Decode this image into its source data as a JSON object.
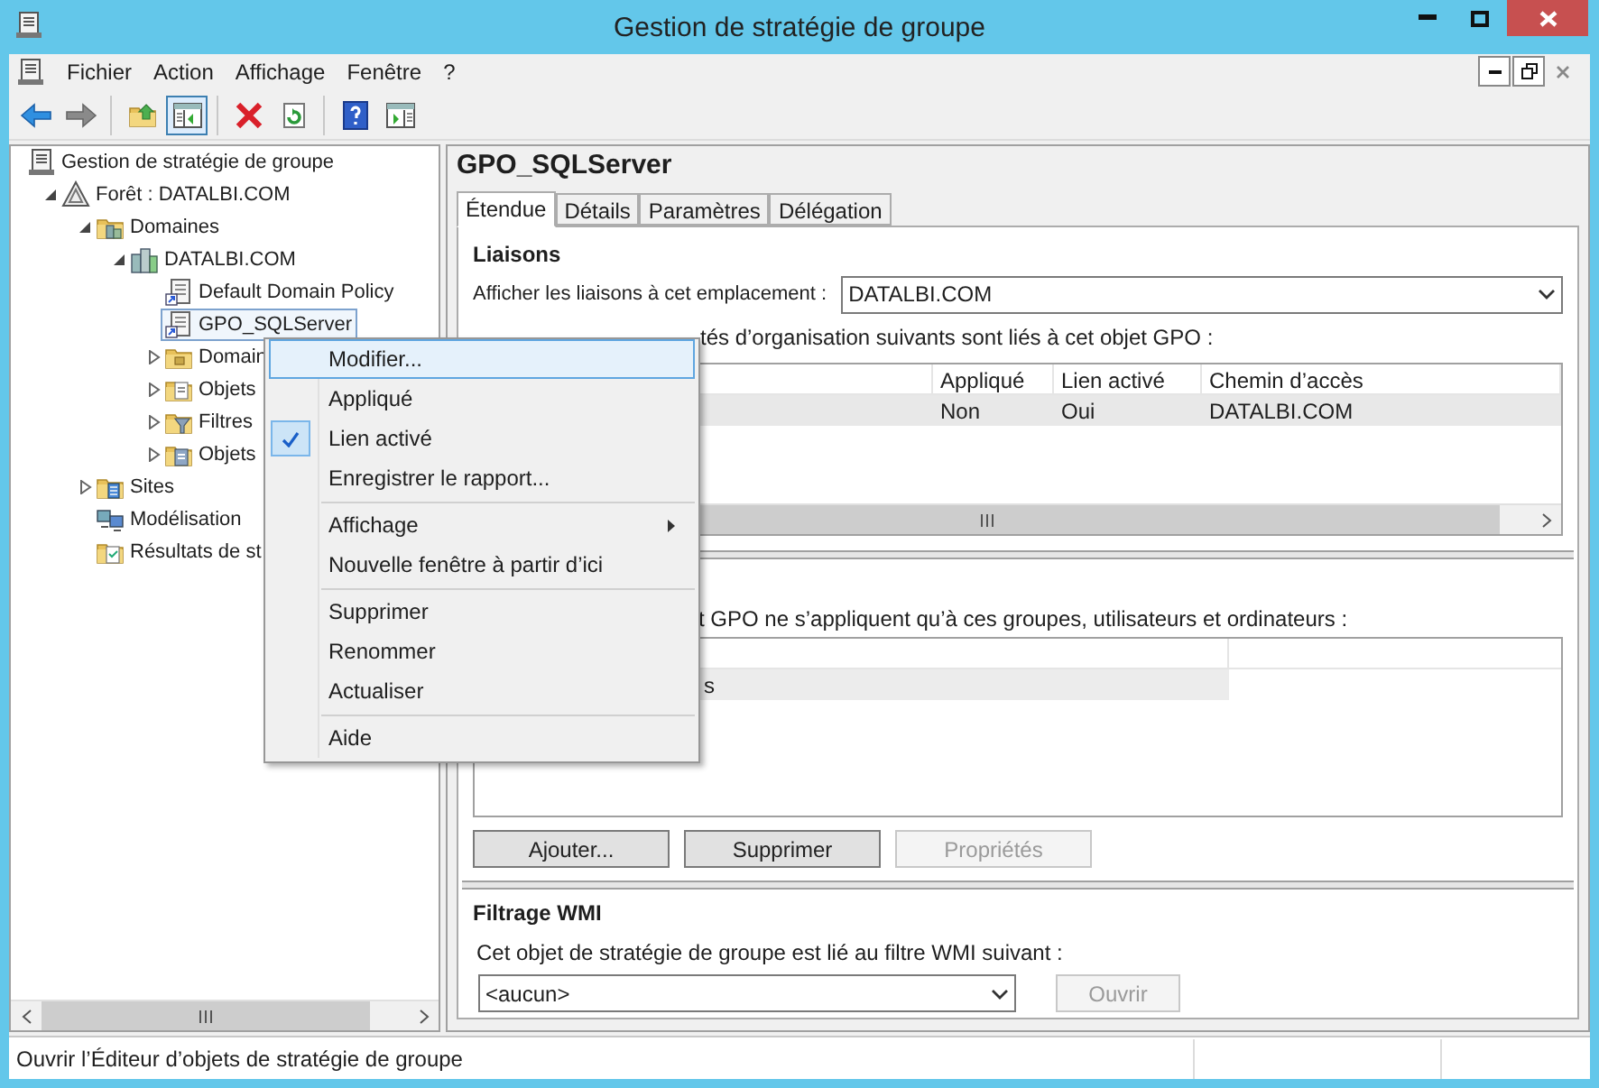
{
  "window": {
    "title": "Gestion de stratégie de groupe"
  },
  "menu_bar": [
    "Fichier",
    "Action",
    "Affichage",
    "Fenêtre",
    "?"
  ],
  "toolbar": [
    {
      "kind": "back",
      "selected": false
    },
    {
      "kind": "forward",
      "selected": false
    },
    {
      "kind": "separator"
    },
    {
      "kind": "up",
      "selected": false
    },
    {
      "kind": "tree",
      "selected": true
    },
    {
      "kind": "separator"
    },
    {
      "kind": "delete",
      "selected": false
    },
    {
      "kind": "export",
      "selected": false
    },
    {
      "kind": "separator"
    },
    {
      "kind": "help",
      "selected": false
    },
    {
      "kind": "panel",
      "selected": false
    }
  ],
  "tree": {
    "kind": "console",
    "label": "Gestion de stratégie de groupe",
    "selected": false,
    "children": [
      {
        "kind": "forest",
        "label": "Forêt : DATALBI.COM",
        "expanded": true,
        "selected": false,
        "children": [
          {
            "kind": "domains",
            "label": "Domaines",
            "expanded": true,
            "selected": false,
            "children": [
              {
                "kind": "domain",
                "label": "DATALBI.COM",
                "expanded": true,
                "selected": false,
                "children": [
                  {
                    "kind": "gpo_link",
                    "label": "Default Domain Policy",
                    "selected": false
                  },
                  {
                    "kind": "gpo_link",
                    "label": "GPO_SQLServer",
                    "selected": true
                  },
                  {
                    "kind": "ou",
                    "label": "Domain",
                    "expanded": false,
                    "selected": false
                  },
                  {
                    "kind": "gpo_folder",
                    "label": "Objets",
                    "expanded": false,
                    "selected": false
                  },
                  {
                    "kind": "wmi_folder",
                    "label": "Filtres",
                    "expanded": false,
                    "selected": false
                  },
                  {
                    "kind": "starter_folder",
                    "label": "Objets",
                    "expanded": false,
                    "selected": false
                  }
                ]
              }
            ]
          },
          {
            "kind": "sites",
            "label": "Sites",
            "expanded": false,
            "selected": false
          },
          {
            "kind": "modeling",
            "label": "Modélisation",
            "selected": false
          },
          {
            "kind": "results",
            "label": "Résultats de st",
            "selected": false
          }
        ]
      }
    ]
  },
  "details": {
    "title": "GPO_SQLServer",
    "tabs": [
      {
        "label": "Étendue",
        "selected": true
      },
      {
        "label": "Détails",
        "selected": false
      },
      {
        "label": "Paramètres",
        "selected": false
      },
      {
        "label": "Délégation",
        "selected": false
      }
    ],
    "links": {
      "heading": "Liaisons",
      "location_label": "Afficher les liaisons à cet emplacement :",
      "location_value": "DATALBI.COM",
      "description": "tés d’organisation suivants sont liés à cet objet GPO :",
      "columns": [
        "Appliqué",
        "Lien activé",
        "Chemin d’accès"
      ],
      "rows": [
        {
          "cells": [
            "Non",
            "Oui",
            "DATALBI.COM"
          ],
          "selected": true
        }
      ]
    },
    "security_filtering": {
      "description": "t GPO ne s’appliquent qu’à ces groupes, utilisateurs et ordinateurs :",
      "rows": [
        {
          "cells": [
            "s"
          ],
          "selected": true
        }
      ],
      "buttons": [
        {
          "label": "Ajouter...",
          "disabled": false
        },
        {
          "label": "Supprimer",
          "disabled": false
        },
        {
          "label": "Propriétés",
          "disabled": true
        }
      ]
    },
    "wmi_filtering": {
      "heading": "Filtrage WMI",
      "label": "Cet objet de stratégie de groupe est lié au filtre WMI suivant :",
      "value": "<aucun>",
      "button": {
        "label": "Ouvrir",
        "disabled": true
      }
    }
  },
  "context_menu": {
    "items": [
      {
        "kind": "item",
        "label": "Modifier...",
        "selected": true,
        "checked": false
      },
      {
        "kind": "item",
        "label": "Appliqué",
        "selected": false,
        "checked": false
      },
      {
        "kind": "item",
        "label": "Lien activé",
        "selected": false,
        "checked": true
      },
      {
        "kind": "item",
        "label": "Enregistrer le rapport...",
        "selected": false,
        "checked": false
      },
      {
        "kind": "separator"
      },
      {
        "kind": "submenu",
        "label": "Affichage",
        "selected": false,
        "checked": false
      },
      {
        "kind": "item",
        "label": "Nouvelle fenêtre à partir d’ici",
        "selected": false,
        "checked": false
      },
      {
        "kind": "separator"
      },
      {
        "kind": "item",
        "label": "Supprimer",
        "selected": false,
        "checked": false
      },
      {
        "kind": "item",
        "label": "Renommer",
        "selected": false,
        "checked": false
      },
      {
        "kind": "item",
        "label": "Actualiser",
        "selected": false,
        "checked": false
      },
      {
        "kind": "separator"
      },
      {
        "kind": "item",
        "label": "Aide",
        "selected": false,
        "checked": false
      }
    ]
  },
  "status_bar": {
    "text": "Ouvrir l’Éditeur d’objets de stratégie de groupe"
  }
}
